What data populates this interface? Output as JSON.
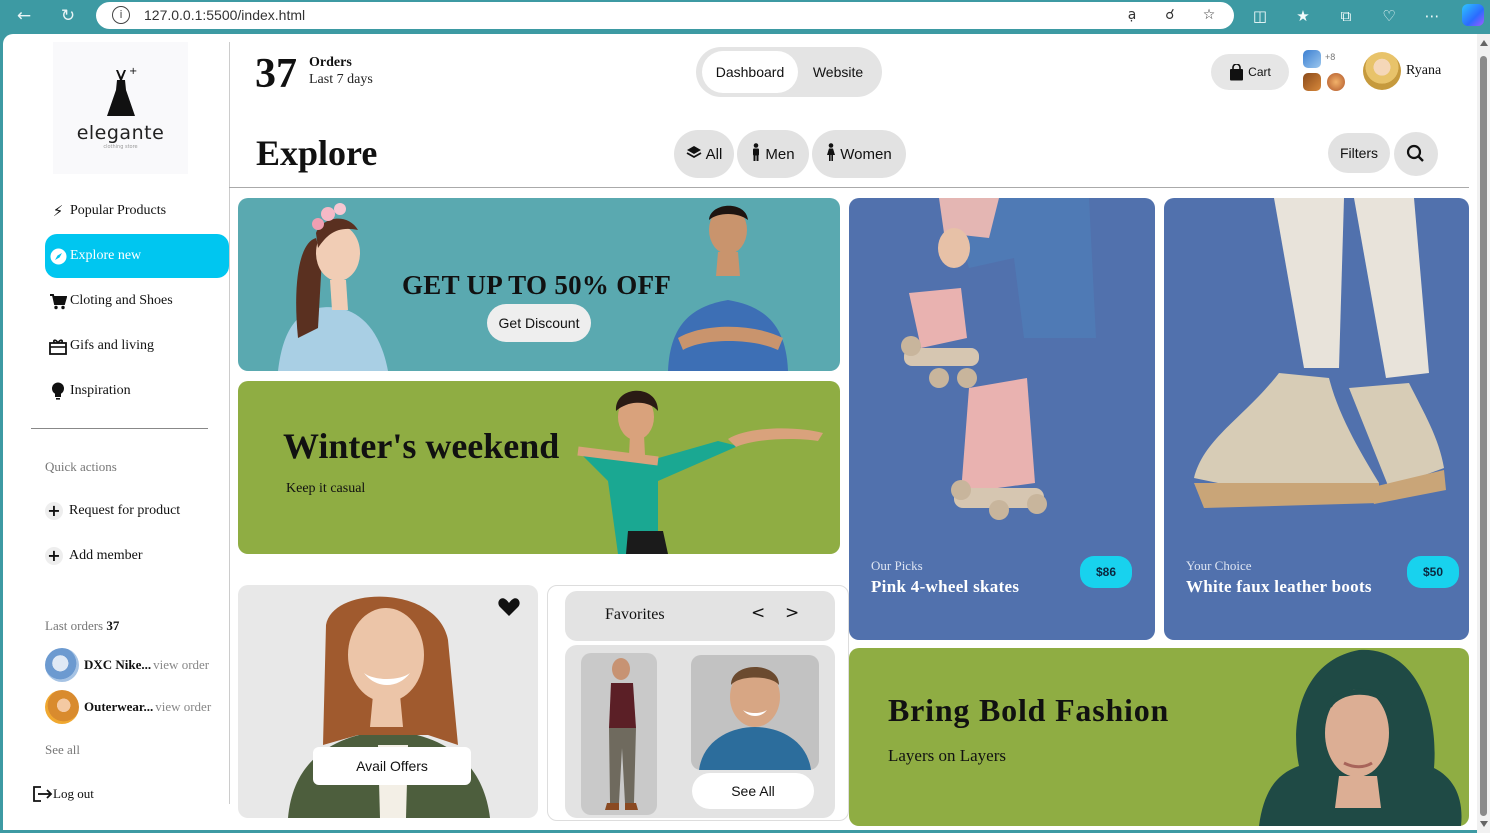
{
  "browser": {
    "url": "127.0.0.1:5500/index.html",
    "icons": [
      "back-icon",
      "reload-icon",
      "info-icon",
      "read-aloud-icon",
      "zoom-icon",
      "favorite-star-icon",
      "split-screen-icon",
      "favorites-icon",
      "collections-icon",
      "browser-essentials-icon",
      "more-icon",
      "copilot-icon"
    ]
  },
  "brand": {
    "name": "elegante",
    "tagline": "clothing store"
  },
  "header": {
    "orders_count": "37",
    "orders_label": "Orders",
    "orders_period": "Last 7 days",
    "toggle": {
      "active": "Dashboard",
      "inactive": "Website"
    },
    "cart_label": "Cart",
    "apps_more": "+8",
    "user_name": "Ryana"
  },
  "sidebar": {
    "items": [
      {
        "label": "Popular Products",
        "icon": "bolt-icon",
        "active": false
      },
      {
        "label": "Explore new",
        "icon": "compass-icon",
        "active": true
      },
      {
        "label": "Cloting and Shoes",
        "icon": "cart-icon",
        "active": false
      },
      {
        "label": "Gifs and living",
        "icon": "gift-icon",
        "active": false
      },
      {
        "label": "Inspiration",
        "icon": "bulb-icon",
        "active": false
      }
    ],
    "quick_actions_title": "Quick actions",
    "quick_actions": [
      "Request for product",
      "Add member"
    ],
    "last_orders_title": "Last orders",
    "last_orders_count": "37",
    "orders": [
      {
        "name": "DXC Nike...",
        "link": "view order"
      },
      {
        "name": "Outerwear...",
        "link": "view order"
      }
    ],
    "see_all": "See all",
    "logout": "Log out"
  },
  "explore": {
    "title": "Explore",
    "filters": [
      "All",
      "Men",
      "Women"
    ],
    "filters_button": "Filters"
  },
  "promo": {
    "headline": "GET UP TO 50% OFF",
    "button": "Get Discount"
  },
  "winter": {
    "title": "Winter's weekend",
    "subtitle": "Keep it casual"
  },
  "offer": {
    "button": "Avail Offers"
  },
  "favorites": {
    "title": "Favorites",
    "prev": "<",
    "next": ">",
    "see_all": "See All"
  },
  "products": [
    {
      "tag": "Our Picks",
      "name": "Pink 4-wheel skates",
      "price": "$86"
    },
    {
      "tag": "Your Choice",
      "name": "White faux leather boots",
      "price": "$50"
    }
  ],
  "bold": {
    "title": "Bring Bold Fashion",
    "subtitle": "Layers on Layers"
  },
  "colors": {
    "accent": "#00c6f0",
    "teal": "#5aa9b0",
    "olive": "#8fad43",
    "blue": "#5171ad",
    "price": "#18d2ee"
  }
}
